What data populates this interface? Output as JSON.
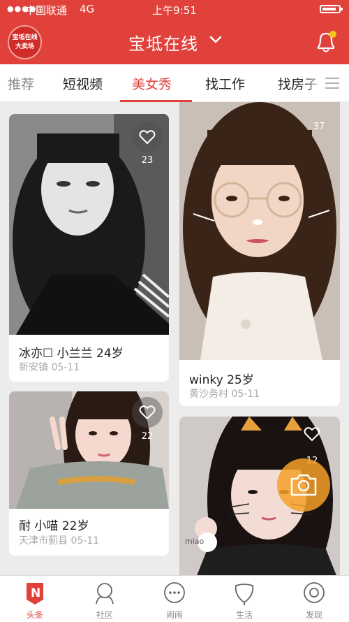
{
  "status_bar": {
    "carrier": "中国联通",
    "network": "4G",
    "time": "上午9:51",
    "battery_level": 0.85
  },
  "header": {
    "logo_text": "宝坻在线大卖场",
    "title": "宝坻在线"
  },
  "tabs": [
    {
      "label": "推荐"
    },
    {
      "label": "短视频"
    },
    {
      "label": "美女秀",
      "active": true
    },
    {
      "label": "找工作"
    },
    {
      "label": "找房子"
    }
  ],
  "cards": [
    {
      "name": "冰亦☐ 小兰兰 24岁",
      "location": "新安镇 05-11",
      "likes": "23"
    },
    {
      "name": "winky 25岁",
      "location": "黄沙务村 05-11",
      "likes": "37"
    },
    {
      "name": "耐 小喵 22岁",
      "location": "天津市蓟县 05-11",
      "likes": "22"
    },
    {
      "likes": "12"
    }
  ],
  "photo_sticker": "miao",
  "bottom_nav": [
    {
      "label": "头条",
      "icon": "news-icon",
      "active": true
    },
    {
      "label": "社区",
      "icon": "community-icon"
    },
    {
      "label": "闹闹",
      "icon": "chat-icon"
    },
    {
      "label": "生活",
      "icon": "life-icon"
    },
    {
      "label": "发现",
      "icon": "discover-icon"
    }
  ],
  "colors": {
    "brand_red": "#e0413b",
    "camera_orange": "#f5a028"
  }
}
